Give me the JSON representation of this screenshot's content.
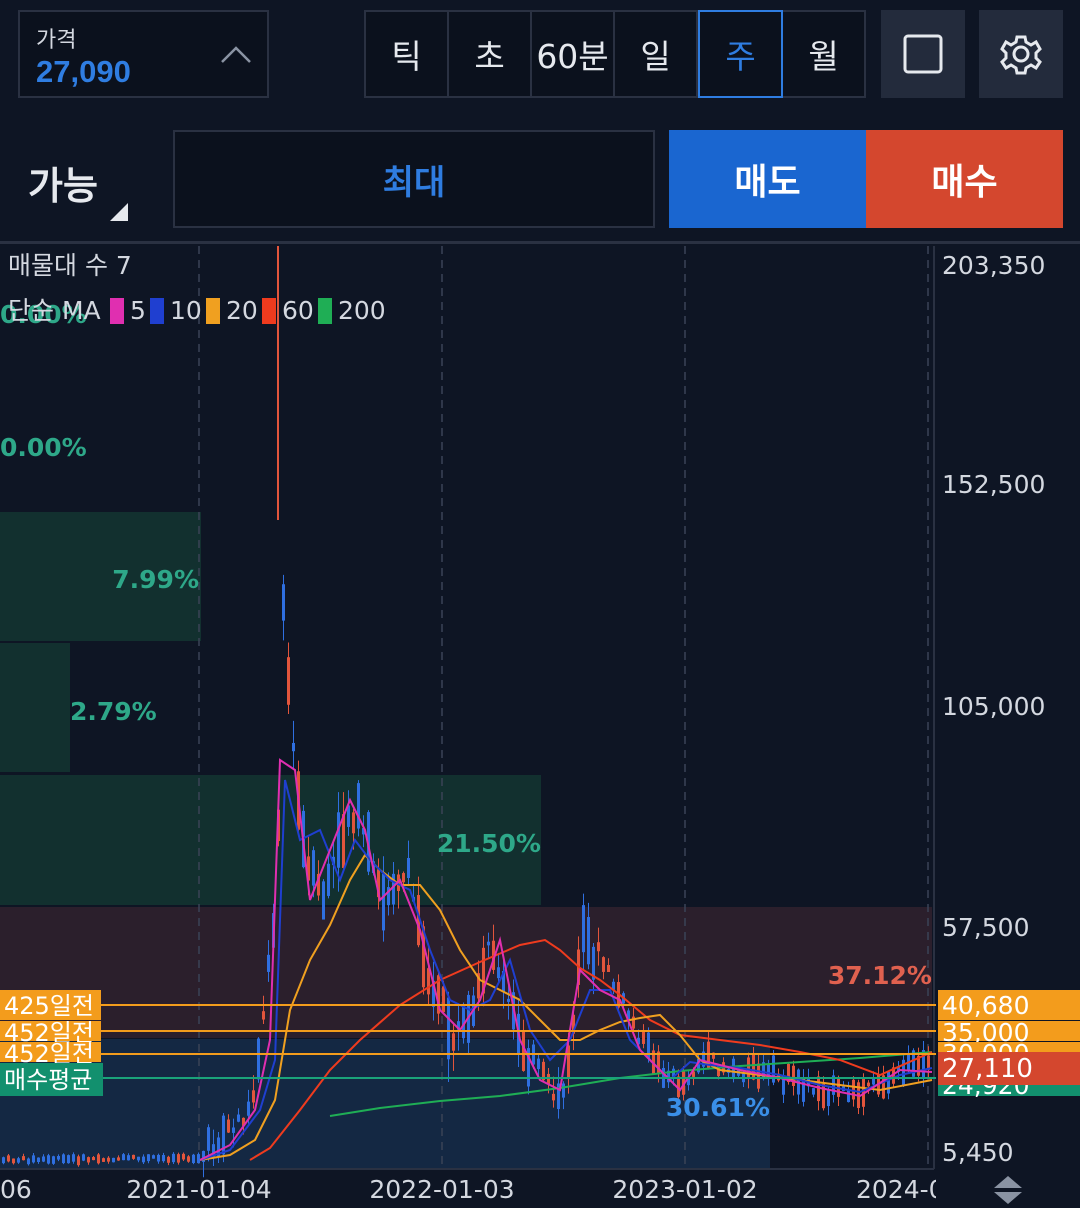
{
  "header": {
    "price_label": "가격",
    "price_value": "27,090",
    "timeframes": [
      "틱",
      "초",
      "60분",
      "일",
      "주",
      "월"
    ],
    "active_timeframe": "주"
  },
  "order": {
    "available_label": "가능",
    "max_label": "최대",
    "sell_label": "매도",
    "buy_label": "매수",
    "sell_color": "#1a66d0",
    "buy_color": "#d4472e"
  },
  "chart": {
    "volume_profile_label": "매물대 수 7",
    "ma_label": "단순 MA",
    "ma_lines": [
      {
        "period": "5",
        "color": "#e02fb0"
      },
      {
        "period": "10",
        "color": "#1f3fd0"
      },
      {
        "period": "20",
        "color": "#f0a020"
      },
      {
        "period": "60",
        "color": "#ef3b1e"
      },
      {
        "period": "200",
        "color": "#1fae55"
      }
    ],
    "y_ticks": [
      "203,350",
      "152,500",
      "105,000",
      "57,500",
      "5,450"
    ],
    "x_ticks": [
      "06",
      "2021-01-04",
      "2022-01-03",
      "2023-01-02",
      "2024-0"
    ],
    "volume_profile": [
      "0.00%",
      "0.00%",
      "7.99%",
      "2.79%",
      "21.50%",
      "37.12%",
      "30.61%"
    ],
    "level_lines": [
      {
        "label": "425일전",
        "price": "40,680"
      },
      {
        "label": "452일전",
        "price": "35,000"
      },
      {
        "label": "452일전",
        "price": "30,000"
      }
    ],
    "avg_buy_label": "매수평균",
    "avg_buy_price": "24,920",
    "current_price": "27,110"
  }
}
